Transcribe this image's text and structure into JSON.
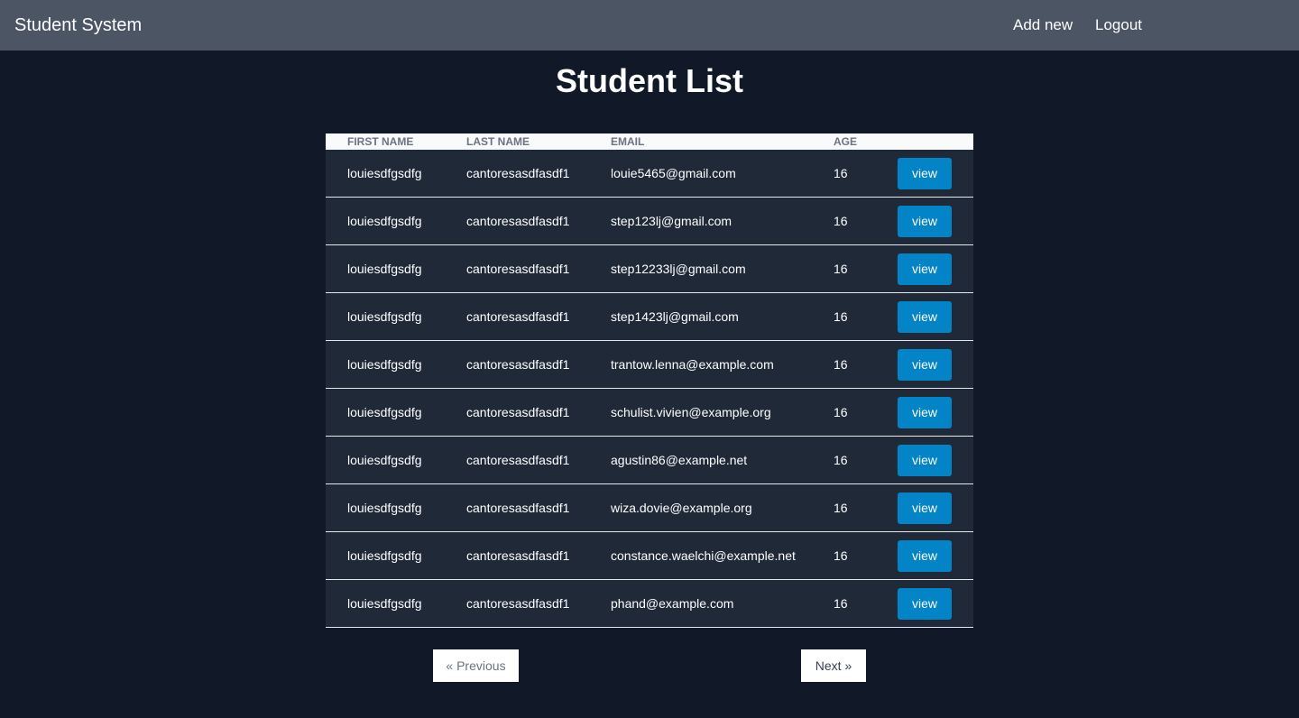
{
  "navbar": {
    "brand": "Student System",
    "links": [
      "Add new",
      "Logout"
    ]
  },
  "page": {
    "title": "Student List"
  },
  "table": {
    "columns": [
      "FIRST NAME",
      "LAST NAME",
      "EMAIL",
      "AGE",
      ""
    ],
    "rows": [
      {
        "first": "louiesdfgsdfg",
        "last": "cantoresasdfasdf1",
        "email": "louie5465@gmail.com",
        "age": "16",
        "action": "view"
      },
      {
        "first": "louiesdfgsdfg",
        "last": "cantoresasdfasdf1",
        "email": "step123lj@gmail.com",
        "age": "16",
        "action": "view"
      },
      {
        "first": "louiesdfgsdfg",
        "last": "cantoresasdfasdf1",
        "email": "step12233lj@gmail.com",
        "age": "16",
        "action": "view"
      },
      {
        "first": "louiesdfgsdfg",
        "last": "cantoresasdfasdf1",
        "email": "step1423lj@gmail.com",
        "age": "16",
        "action": "view"
      },
      {
        "first": "louiesdfgsdfg",
        "last": "cantoresasdfasdf1",
        "email": "trantow.lenna@example.com",
        "age": "16",
        "action": "view"
      },
      {
        "first": "louiesdfgsdfg",
        "last": "cantoresasdfasdf1",
        "email": "schulist.vivien@example.org",
        "age": "16",
        "action": "view"
      },
      {
        "first": "louiesdfgsdfg",
        "last": "cantoresasdfasdf1",
        "email": "agustin86@example.net",
        "age": "16",
        "action": "view"
      },
      {
        "first": "louiesdfgsdfg",
        "last": "cantoresasdfasdf1",
        "email": "wiza.dovie@example.org",
        "age": "16",
        "action": "view"
      },
      {
        "first": "louiesdfgsdfg",
        "last": "cantoresasdfasdf1",
        "email": "constance.waelchi@example.net",
        "age": "16",
        "action": "view"
      },
      {
        "first": "louiesdfgsdfg",
        "last": "cantoresasdfasdf1",
        "email": "phand@example.com",
        "age": "16",
        "action": "view"
      }
    ]
  },
  "pagination": {
    "previous_label": "« Previous",
    "next_label": "Next »"
  },
  "colors": {
    "background": "#111827",
    "navbar": "#4b5563",
    "row": "#1f2937",
    "button": "#0284c7"
  }
}
